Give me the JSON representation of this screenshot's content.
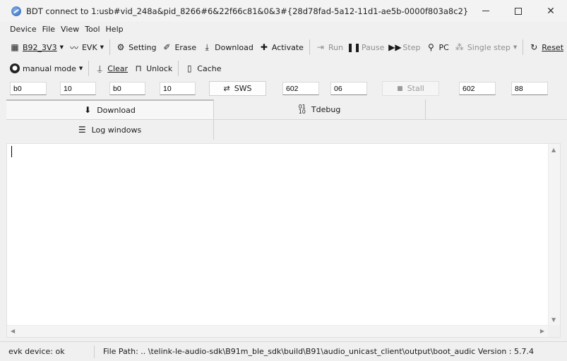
{
  "window": {
    "title": "BDT connect to 1:usb#vid_248a&pid_8266#6&22f66c81&0&3#{28d78fad-5a12-11d1-ae5b-0000f803a8c2}",
    "minimize": "—",
    "maximize": "☐",
    "close": "✕"
  },
  "menu": [
    "Device",
    "File",
    "View",
    "Tool",
    "Help"
  ],
  "toolbar1": {
    "chip": "B92_3V3",
    "board": "EVK",
    "setting": "Setting",
    "erase": "Erase",
    "download": "Download",
    "activate": "Activate",
    "run": "Run",
    "pause": "Pause",
    "step": "Step",
    "pc": "PC",
    "single_step": "Single step",
    "reset": "Reset"
  },
  "toolbar2": {
    "mode": "manual mode",
    "clear": "Clear",
    "unlock": "Unlock",
    "cache": "Cache"
  },
  "fields": {
    "f1": "b0",
    "f2": "10",
    "f3": "b0",
    "f4": "10",
    "sws": "SWS",
    "f5": "602",
    "f6": "06",
    "stall": "Stall",
    "f7": "602",
    "f8": "88"
  },
  "tabs": {
    "download": "Download",
    "tdebug": "Tdebug",
    "log_windows": "Log windows"
  },
  "status": {
    "device": "evk device: ok",
    "path": "File Path:   ..  \\telink-le-audio-sdk\\B91m_ble_sdk\\build\\B91\\audio_unicast_client\\output\\boot_audic Version : 5.7.4"
  },
  "icons": {
    "download": "down-arrow-icon",
    "tdebug": "binary-icon",
    "log": "list-icon"
  }
}
